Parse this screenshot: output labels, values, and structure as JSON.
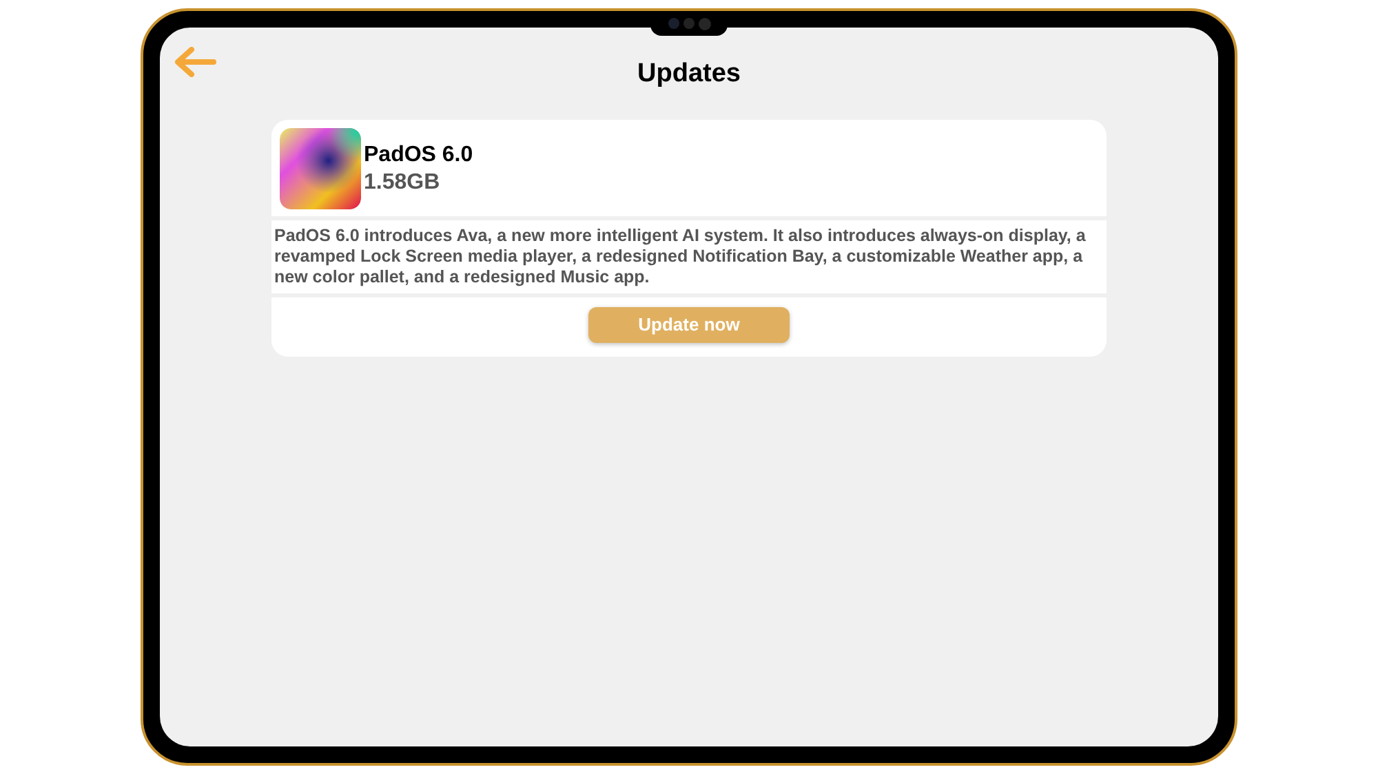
{
  "screen": {
    "title": "Updates"
  },
  "update": {
    "name": "PadOS 6.0",
    "size": "1.58GB",
    "description": "PadOS 6.0 introduces Ava, a new more intelligent AI system. It also introduces always-on display, a revamped Lock Screen media player, a redesigned Notification Bay, a customizable Weather app, a new color pallet, and a redesigned Music app.",
    "button": "Update now"
  }
}
